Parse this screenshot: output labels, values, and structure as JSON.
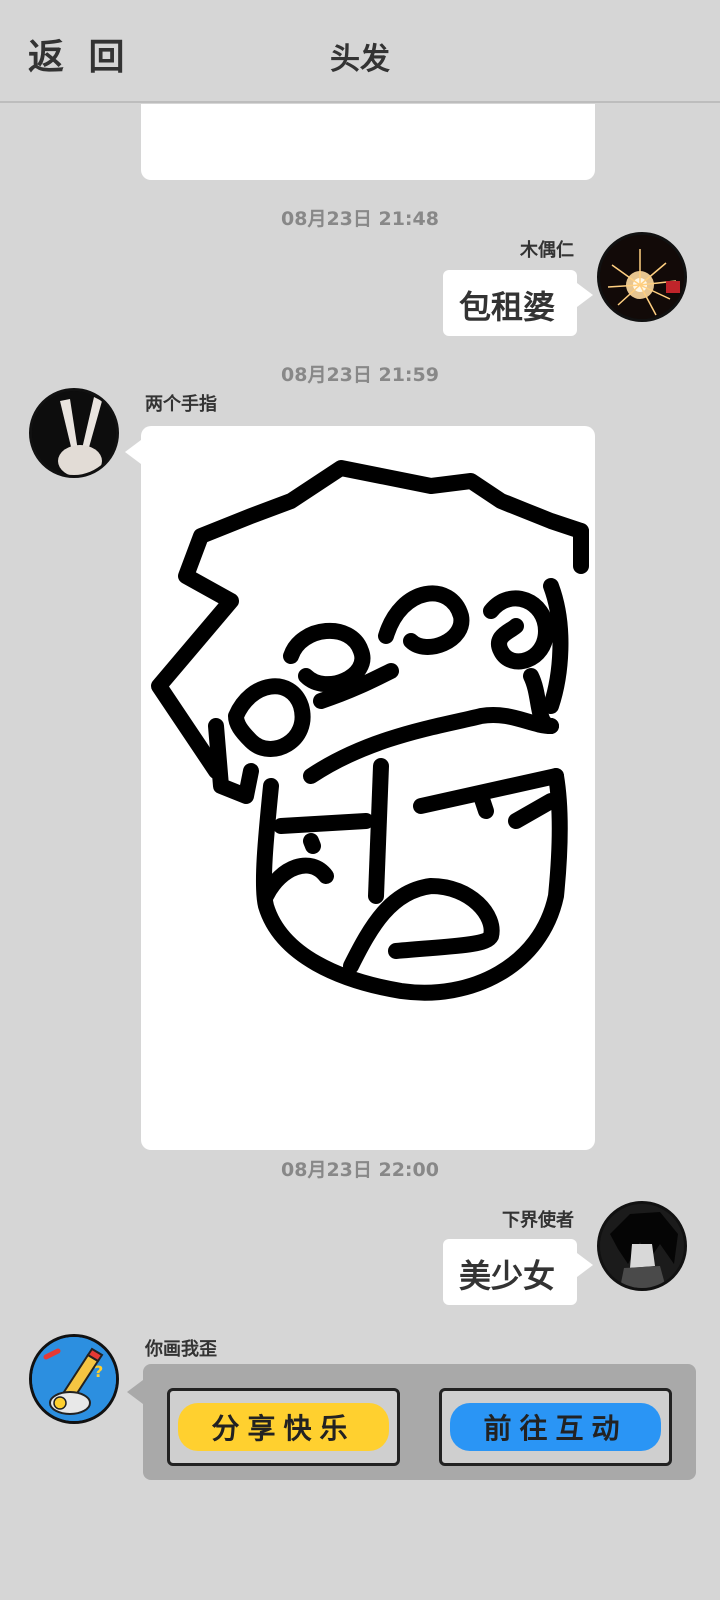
{
  "header": {
    "back_label": "返 回",
    "title": "头发"
  },
  "messages": [
    {
      "time": "08月23日  21:48",
      "name": "木偶仁",
      "text": "包租婆"
    },
    {
      "time": "08月23日  21:59",
      "name": "两个手指"
    },
    {
      "time": "08月23日  22:00",
      "name": "下界使者",
      "text": "美少女"
    },
    {
      "name": "你画我歪"
    }
  ],
  "actions": {
    "share_label": "分享快乐",
    "interact_label": "前往互动",
    "share_color": "#ffd02f",
    "interact_color": "#2a95f5"
  }
}
